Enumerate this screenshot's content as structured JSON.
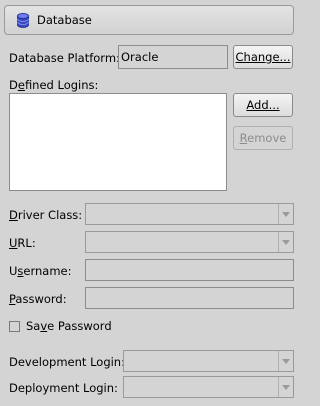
{
  "header": {
    "title": "Database",
    "icon": "database-icon"
  },
  "platform": {
    "label": "Database Platform:",
    "value": "Oracle",
    "change_button": "Change..."
  },
  "logins": {
    "label_mnemonic": "e",
    "label_before": "D",
    "label_after": "fined Logins:",
    "add_button": "Add...",
    "remove_button_mnemonic": "R",
    "remove_button_rest": "emove",
    "items": []
  },
  "driver": {
    "label_mnemonic": "D",
    "label_rest": "river Class:",
    "value": ""
  },
  "url": {
    "label_mnemonic": "U",
    "label_rest": "RL:",
    "value": ""
  },
  "username": {
    "label_before": "U",
    "label_mnemonic": "s",
    "label_after": "ername:",
    "value": ""
  },
  "password": {
    "label_mnemonic": "P",
    "label_rest": "assword:",
    "value": ""
  },
  "save_password": {
    "label_before": "Sa",
    "label_mnemonic": "v",
    "label_after": "e Password",
    "checked": false
  },
  "development_login": {
    "label": "Development Login:",
    "value": ""
  },
  "deployment_login": {
    "label": "Deployment Login:",
    "value": ""
  },
  "colors": {
    "background": "#d4d4d4",
    "disabled_text": "#8c8c8c"
  }
}
